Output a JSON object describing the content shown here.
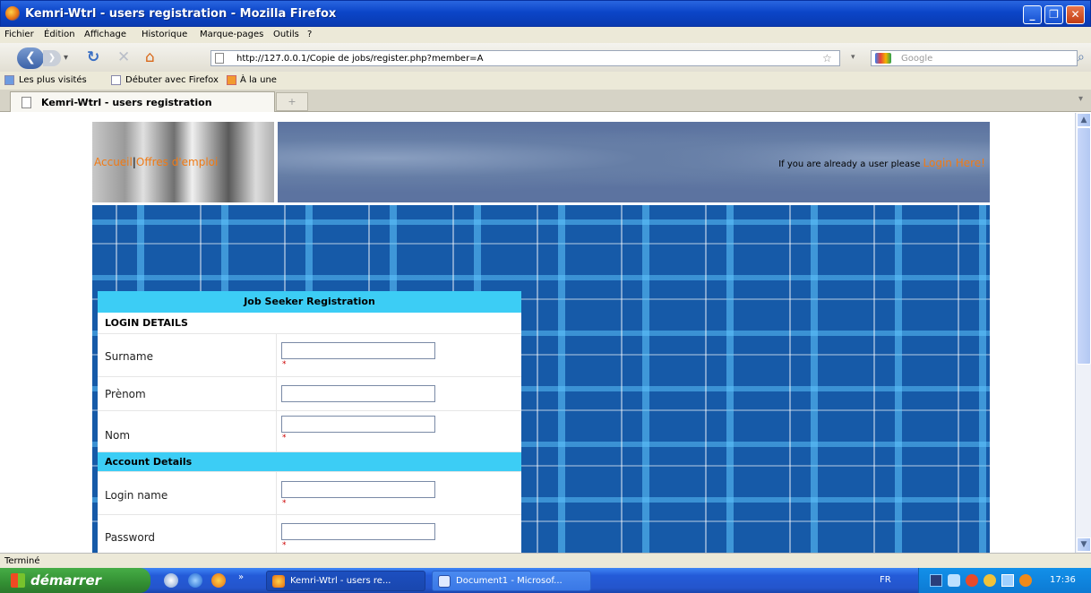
{
  "window": {
    "title": "Kemri-Wtrl - users registration - Mozilla Firefox"
  },
  "menu": [
    "Fichier",
    "Édition",
    "Affichage",
    "Historique",
    "Marque-pages",
    "Outils",
    "?"
  ],
  "nav": {
    "url": "http://127.0.0.1/Copie de jobs/register.php?member=A",
    "search_placeholder": "Google"
  },
  "bookmarks": [
    "Les plus visités",
    "Débuter avec Firefox",
    "À la une"
  ],
  "tab": {
    "label": "Kemri-Wtrl - users registration",
    "new_tab": "+"
  },
  "page": {
    "nav_home": "Accueil",
    "nav_sep": "|",
    "nav_jobs": "Offres d'emploi",
    "login_prompt": "If you are already a user please",
    "login_link": "Login Here!",
    "form": {
      "title": "Job Seeker Registration",
      "login_section": "LOGIN DETAILS",
      "account_section": "Account Details",
      "surname_label": "Surname",
      "prenom_label": "Prènom",
      "nom_label": "Nom",
      "login_label": "Login name",
      "password_label": "Password",
      "required_mark": "*"
    }
  },
  "status": {
    "text": "Terminé"
  },
  "taskbar": {
    "start": "démarrer",
    "btn1": "Kemri-Wtrl - users re...",
    "btn2": "Document1 - Microsof...",
    "lang": "FR",
    "clock": "17:36",
    "more": "»"
  }
}
